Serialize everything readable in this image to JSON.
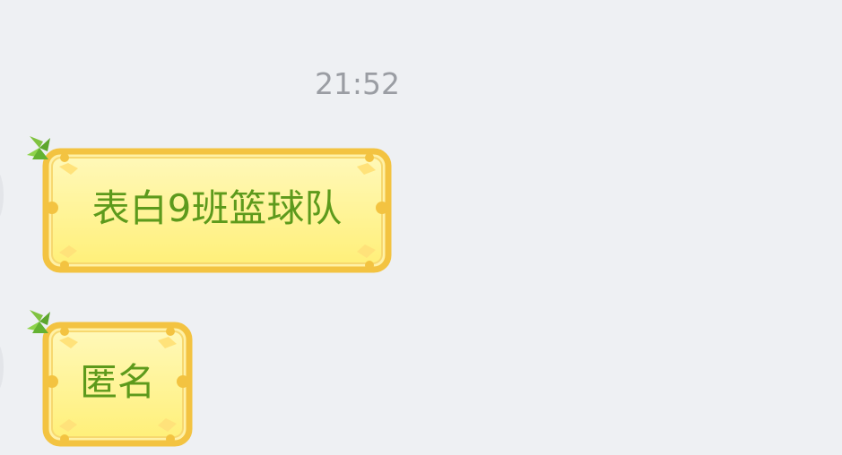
{
  "chat": {
    "timestamp": "21:52",
    "messages": [
      {
        "text": "表白9班篮球队"
      },
      {
        "text": "匿名"
      }
    ]
  },
  "theme": {
    "background": "#eef0f3",
    "bubble_fill": "#fff59a",
    "bubble_border": "#f3c341",
    "text_color": "#5d9a1c",
    "decoration_icon": "leaf-icon"
  }
}
